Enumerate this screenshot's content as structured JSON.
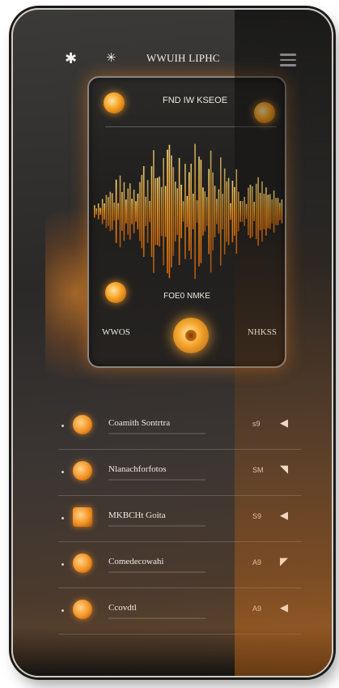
{
  "header": {
    "left_icon": "sparkle-icon",
    "second_icon": "star-icon",
    "title": "WWUIH LIPHC",
    "menu_icon": "hamburger-menu-icon"
  },
  "player": {
    "caption": "FND IW KSEOE",
    "track_label": "FOE0 NMKE",
    "left_label": "WWOS",
    "right_label": "NHKSS",
    "accent_color": "#f6a224",
    "visualizer": "waveform"
  },
  "playlist": [
    {
      "name": "Coamith Sontrtra",
      "duration": "s9",
      "shape": "circle"
    },
    {
      "name": "Nlanachforfotos",
      "duration": "SM",
      "shape": "circle"
    },
    {
      "name": "MKBCHt Goita",
      "duration": "S9",
      "shape": "square"
    },
    {
      "name": "Comedecowahi",
      "duration": "A9",
      "shape": "circle"
    },
    {
      "name": "Ccovdtl",
      "duration": "A9",
      "shape": "circle"
    }
  ],
  "colors": {
    "background": "#2a2928",
    "accent": "#f39223",
    "text": "#efebe4"
  }
}
